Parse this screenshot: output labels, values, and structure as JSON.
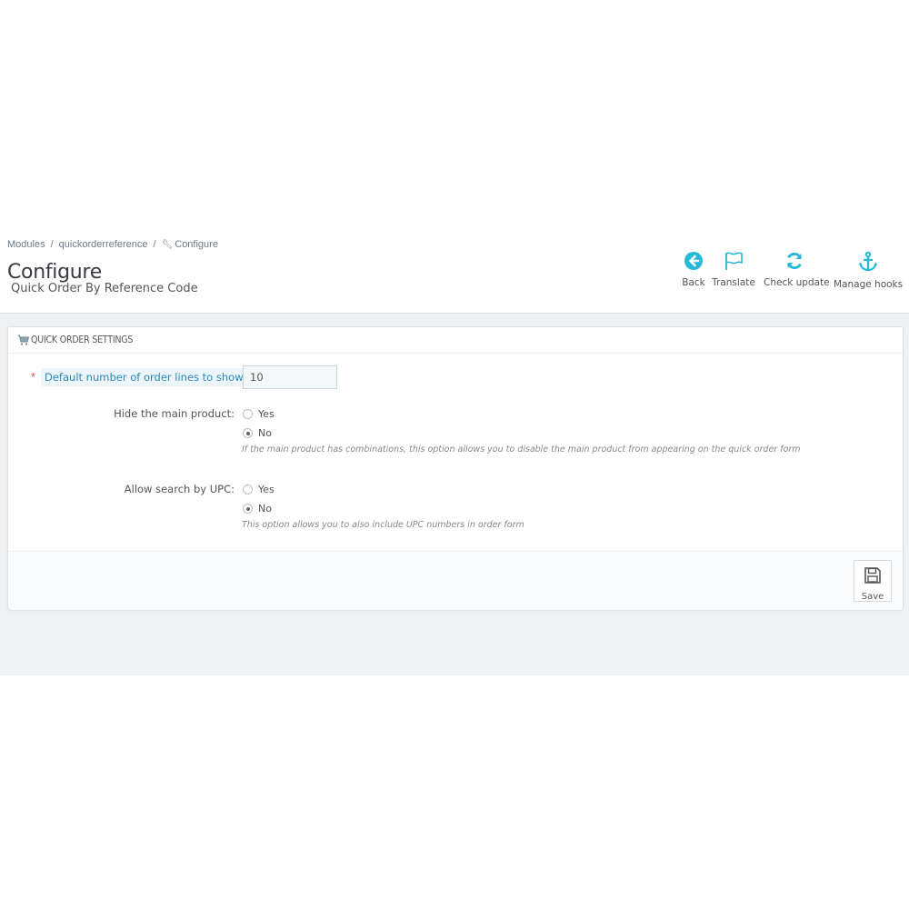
{
  "breadcrumb": {
    "items": [
      "Modules",
      "quickorderreference",
      "Configure"
    ],
    "separator": "/"
  },
  "header": {
    "title": "Configure",
    "subtitle": "Quick Order By Reference Code"
  },
  "toolbar": {
    "back_label": "Back",
    "translate_label": "Translate",
    "check_update_label": "Check update",
    "manage_hooks_label": "Manage hooks",
    "icon_color": "#25b9d7"
  },
  "panel": {
    "title": "QUICK ORDER SETTINGS",
    "fields": {
      "order_lines": {
        "required_mark": "*",
        "label": "Default number of order lines to show:",
        "value": "10"
      },
      "hide_main_product": {
        "label": "Hide the main product:",
        "options": [
          "Yes",
          "No"
        ],
        "selected": "No",
        "help": "If the main product has combinations, this option allows you to disable the main product from appearing on the quick order form"
      },
      "search_upc": {
        "label": "Allow search by UPC:",
        "options": [
          "Yes",
          "No"
        ],
        "selected": "No",
        "help": "This option allows you to also include UPC numbers in order form"
      }
    },
    "save_label": "Save"
  }
}
